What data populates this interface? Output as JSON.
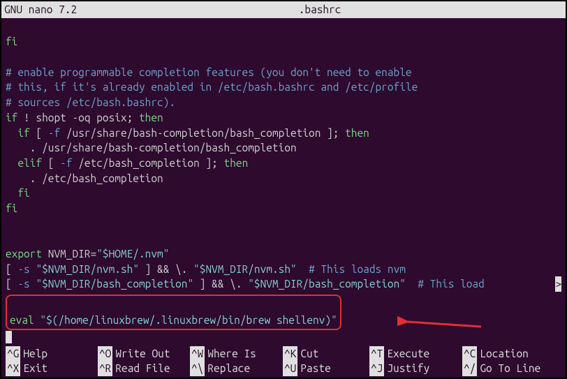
{
  "title": {
    "app": "GNU nano 7.2",
    "filename": ".bashrc"
  },
  "lines": {
    "l1": "fi",
    "l2": "# enable programmable completion features (you don't need to enable",
    "l3": "# this, if it's already enabled in /etc/bash.bashrc and /etc/profile",
    "l4": "# sources /etc/bash.bashrc).",
    "l5a": "if",
    "l5b": " ! shopt -oq posix; ",
    "l5c": "then",
    "l6a": "  if",
    "l6b": " [ ",
    "l6c": "-f",
    "l6d": " /usr/share/bash-completion/bash_completion ]; ",
    "l6e": "then",
    "l7": "    . /usr/share/bash-completion/bash_completion",
    "l8a": "  elif",
    "l8b": " [ ",
    "l8c": "-f",
    "l8d": " /etc/bash_completion ]; ",
    "l8e": "then",
    "l9": "    . /etc/bash_completion",
    "l10a": "  fi",
    "l11": "fi",
    "l13a": "export",
    "l13b": " NVM_DIR=",
    "l13c": "\"$HOME/.nvm\"",
    "l14a": "[ ",
    "l14b": "-s",
    "l14c": " ",
    "l14d": "\"$NVM_DIR/nvm.sh\"",
    "l14e": " ] && \\. ",
    "l14f": "\"$NVM_DIR/nvm.sh\"",
    "l14g": "  ",
    "l14h": "# This loads nvm",
    "l15a": "[ ",
    "l15b": "-s",
    "l15c": " ",
    "l15d": "\"$NVM_DIR/bash_completion\"",
    "l15e": " ] && \\. ",
    "l15f": "\"$NVM_DIR/bash_completion\"",
    "l15g": "  ",
    "l15h": "# This load",
    "eval_a": "eval",
    "eval_b": " ",
    "eval_c": "\"$(/home/linuxbrew/.linuxbrew/bin/brew shellenv)\"",
    "trunc": ">"
  },
  "help": {
    "r1": [
      {
        "key": "^G",
        "label": "Help"
      },
      {
        "key": "^O",
        "label": "Write Out"
      },
      {
        "key": "^W",
        "label": "Where Is"
      },
      {
        "key": "^K",
        "label": "Cut"
      },
      {
        "key": "^T",
        "label": "Execute"
      },
      {
        "key": "^C",
        "label": "Location"
      }
    ],
    "r2": [
      {
        "key": "^X",
        "label": "Exit"
      },
      {
        "key": "^R",
        "label": "Read File"
      },
      {
        "key": "^\\",
        "label": "Replace"
      },
      {
        "key": "^U",
        "label": "Paste"
      },
      {
        "key": "^J",
        "label": "Justify"
      },
      {
        "key": "^/",
        "label": "Go To Line"
      }
    ]
  }
}
